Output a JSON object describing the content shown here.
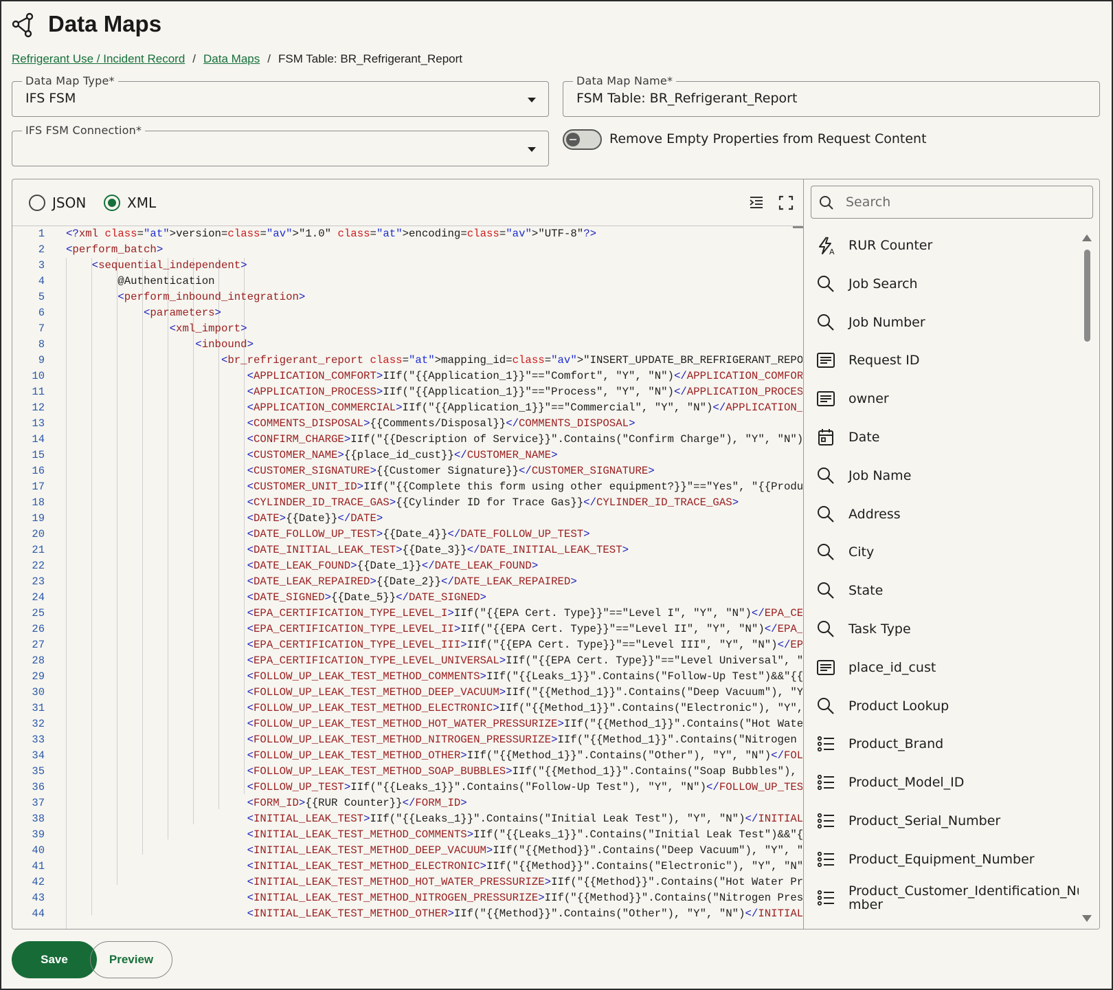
{
  "header": {
    "title": "Data Maps",
    "icon": "share-nodes-icon"
  },
  "breadcrumb": {
    "items": [
      "Refrigerant Use / Incident Record",
      "Data Maps"
    ],
    "separator": "/",
    "current": "FSM Table: BR_Refrigerant_Report"
  },
  "form": {
    "map_type": {
      "label": "Data Map Type*",
      "value": "IFS FSM"
    },
    "map_name": {
      "label": "Data Map Name*",
      "value": "FSM Table: BR_Refrigerant_Report"
    },
    "connection": {
      "label": "IFS FSM Connection*",
      "value": ""
    },
    "remove_empty": {
      "label": "Remove Empty Properties from Request Content",
      "enabled": false
    }
  },
  "editor": {
    "formats": [
      {
        "label": "JSON",
        "selected": false
      },
      {
        "label": "XML",
        "selected": true
      }
    ],
    "line_numbers": [
      "1",
      "2",
      "3",
      "4",
      "5",
      "6",
      "7",
      "8",
      "9",
      "10",
      "11",
      "12",
      "13",
      "14",
      "15",
      "16",
      "17",
      "18",
      "19",
      "20",
      "21",
      "22",
      "23",
      "24",
      "25",
      "26",
      "27",
      "28",
      "29",
      "30",
      "31",
      "32",
      "33",
      "34",
      "35",
      "36",
      "37",
      "38",
      "39",
      "40",
      "41",
      "42",
      "43",
      "44"
    ],
    "lines": [
      "<?xml version=\"1.0\" encoding=\"UTF-8\"?>",
      "<perform_batch>",
      "    <sequential_independent>",
      "        @Authentication",
      "        <perform_inbound_integration>",
      "            <parameters>",
      "                <xml_import>",
      "                    <inbound>",
      "                        <br_refrigerant_report mapping_id=\"INSERT_UPDATE_BR_REFRIGERANT_REPORT\">",
      "                            <APPLICATION_COMFORT>IIf(\"{{Application_1}}\"==\"Comfort\", \"Y\", \"N\")</APPLICATION_COMFORT>",
      "                            <APPLICATION_PROCESS>IIf(\"{{Application_1}}\"==\"Process\", \"Y\", \"N\")</APPLICATION_PROCESS>",
      "                            <APPLICATION_COMMERCIAL>IIf(\"{{Application_1}}\"==\"Commercial\", \"Y\", \"N\")</APPLICATION_COMMERCIAL>",
      "                            <COMMENTS_DISPOSAL>{{Comments/Disposal}}</COMMENTS_DISPOSAL>",
      "                            <CONFIRM_CHARGE>IIf(\"{{Description of Service}}\".Contains(\"Confirm Charge\"), \"Y\", \"N\")</CONFIRM_CHARGE>",
      "                            <CUSTOMER_NAME>{{place_id_cust}}</CUSTOMER_NAME>",
      "                            <CUSTOMER_SIGNATURE>{{Customer Signature}}</CUSTOMER_SIGNATURE>",
      "                            <CUSTOMER_UNIT_ID>IIf(\"{{Complete this form using other equipment?}}\"==\"Yes\", \"{{Product_",
      "                            <CYLINDER_ID_TRACE_GAS>{{Cylinder ID for Trace Gas}}</CYLINDER_ID_TRACE_GAS>",
      "                            <DATE>{{Date}}</DATE>",
      "                            <DATE_FOLLOW_UP_TEST>{{Date_4}}</DATE_FOLLOW_UP_TEST>",
      "                            <DATE_INITIAL_LEAK_TEST>{{Date_3}}</DATE_INITIAL_LEAK_TEST>",
      "                            <DATE_LEAK_FOUND>{{Date_1}}</DATE_LEAK_FOUND>",
      "                            <DATE_LEAK_REPAIRED>{{Date_2}}</DATE_LEAK_REPAIRED>",
      "                            <DATE_SIGNED>{{Date_5}}</DATE_SIGNED>",
      "                            <EPA_CERTIFICATION_TYPE_LEVEL_I>IIf(\"{{EPA Cert. Type}}\"==\"Level I\", \"Y\", \"N\")</EPA_CERT",
      "                            <EPA_CERTIFICATION_TYPE_LEVEL_II>IIf(\"{{EPA Cert. Type}}\"==\"Level II\", \"Y\", \"N\")</EPA_CE",
      "                            <EPA_CERTIFICATION_TYPE_LEVEL_III>IIf(\"{{EPA Cert. Type}}\"==\"Level III\", \"Y\", \"N\")</EPA_",
      "                            <EPA_CERTIFICATION_TYPE_LEVEL_UNIVERSAL>IIf(\"{{EPA Cert. Type}}\"==\"Level Universal\", \"Y",
      "                            <FOLLOW_UP_LEAK_TEST_METHOD_COMMENTS>IIf(\"{{Leaks_1}}\".Contains(\"Follow-Up Test\")&&\"{{Me",
      "                            <FOLLOW_UP_LEAK_TEST_METHOD_DEEP_VACUUM>IIf(\"{{Method_1}}\".Contains(\"Deep Vacuum\"), \"Y\",",
      "                            <FOLLOW_UP_LEAK_TEST_METHOD_ELECTRONIC>IIf(\"{{Method_1}}\".Contains(\"Electronic\"), \"Y\", \"",
      "                            <FOLLOW_UP_LEAK_TEST_METHOD_HOT_WATER_PRESSURIZE>IIf(\"{{Method_1}}\".Contains(\"Hot Water ",
      "                            <FOLLOW_UP_LEAK_TEST_METHOD_NITROGEN_PRESSURIZE>IIf(\"{{Method_1}}\".Contains(\"Nitrogen Pr",
      "                            <FOLLOW_UP_LEAK_TEST_METHOD_OTHER>IIf(\"{{Method_1}}\".Contains(\"Other\"), \"Y\", \"N\")</FOLLO",
      "                            <FOLLOW_UP_LEAK_TEST_METHOD_SOAP_BUBBLES>IIf(\"{{Method_1}}\".Contains(\"Soap Bubbles\"), \"Y",
      "                            <FOLLOW_UP_TEST>IIf(\"{{Leaks_1}}\".Contains(\"Follow-Up Test\"), \"Y\", \"N\")</FOLLOW_UP_TEST>",
      "                            <FORM_ID>{{RUR Counter}}</FORM_ID>",
      "                            <INITIAL_LEAK_TEST>IIf(\"{{Leaks_1}}\".Contains(\"Initial Leak Test\"), \"Y\", \"N\")</INITIAL_L",
      "                            <INITIAL_LEAK_TEST_METHOD_COMMENTS>IIf(\"{{Leaks_1}}\".Contains(\"Initial Leak Test\")&&\"{{M",
      "                            <INITIAL_LEAK_TEST_METHOD_DEEP_VACUUM>IIf(\"{{Method}}\".Contains(\"Deep Vacuum\"), \"Y\", \"N\"",
      "                            <INITIAL_LEAK_TEST_METHOD_ELECTRONIC>IIf(\"{{Method}}\".Contains(\"Electronic\"), \"Y\", \"N\")<",
      "                            <INITIAL_LEAK_TEST_METHOD_HOT_WATER_PRESSURIZE>IIf(\"{{Method}}\".Contains(\"Hot Water Pres",
      "                            <INITIAL_LEAK_TEST_METHOD_NITROGEN_PRESSURIZE>IIf(\"{{Method}}\".Contains(\"Nitrogen Pressu",
      "                            <INITIAL_LEAK_TEST_METHOD_OTHER>IIf(\"{{Method}}\".Contains(\"Other\"), \"Y\", \"N\")</INITIAL_L"
    ]
  },
  "variables": {
    "search_placeholder": "Search",
    "items": [
      {
        "label": "RUR Counter",
        "icon": "counter-bolt-icon"
      },
      {
        "label": "Job Search",
        "icon": "search-icon"
      },
      {
        "label": "Job Number",
        "icon": "search-icon"
      },
      {
        "label": "Request ID",
        "icon": "text-field-icon"
      },
      {
        "label": "owner",
        "icon": "text-field-icon"
      },
      {
        "label": "Date",
        "icon": "calendar-icon"
      },
      {
        "label": "Job Name",
        "icon": "search-icon"
      },
      {
        "label": "Address",
        "icon": "search-icon"
      },
      {
        "label": "City",
        "icon": "search-icon"
      },
      {
        "label": "State",
        "icon": "search-icon"
      },
      {
        "label": "Task Type",
        "icon": "search-icon"
      },
      {
        "label": "place_id_cust",
        "icon": "text-field-icon"
      },
      {
        "label": "Product Lookup",
        "icon": "search-icon"
      },
      {
        "label": "Product_Brand",
        "icon": "list-icon"
      },
      {
        "label": "Product_Model_ID",
        "icon": "list-icon"
      },
      {
        "label": "Product_Serial_Number",
        "icon": "list-icon"
      },
      {
        "label": "Product_Equipment_Number",
        "icon": "list-icon"
      },
      {
        "label": "Product_Customer_Identification_Nu mber",
        "icon": "list-icon"
      }
    ]
  },
  "actions": {
    "save_label": "Save",
    "preview_label": "Preview"
  },
  "colors": {
    "accent": "#176b37",
    "link": "#16703a",
    "line_number": "#2a58a8",
    "tag": "#1b1fb8",
    "attr": "#cc1b1b"
  }
}
